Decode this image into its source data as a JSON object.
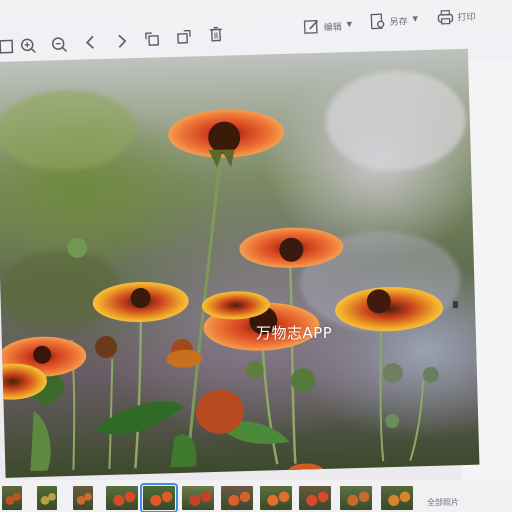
{
  "toolbar": {
    "left_icons": [
      "fit-window-icon",
      "zoom-in-icon",
      "zoom-out-icon",
      "previous-icon",
      "next-icon",
      "rotate-left-icon",
      "rotate-right-icon",
      "delete-icon"
    ],
    "edit_label": "编辑",
    "save_label": "另存",
    "print_label": "打印"
  },
  "photo": {
    "watermark": "万物志APP"
  },
  "filmstrip": {
    "thumbnail_count": 11,
    "selected_index": 4,
    "all_photos_label": "全部照片"
  },
  "colors": {
    "selection": "#3f8ee8",
    "petal_orange": "#e8552a",
    "petal_yellow": "#f0a820"
  }
}
